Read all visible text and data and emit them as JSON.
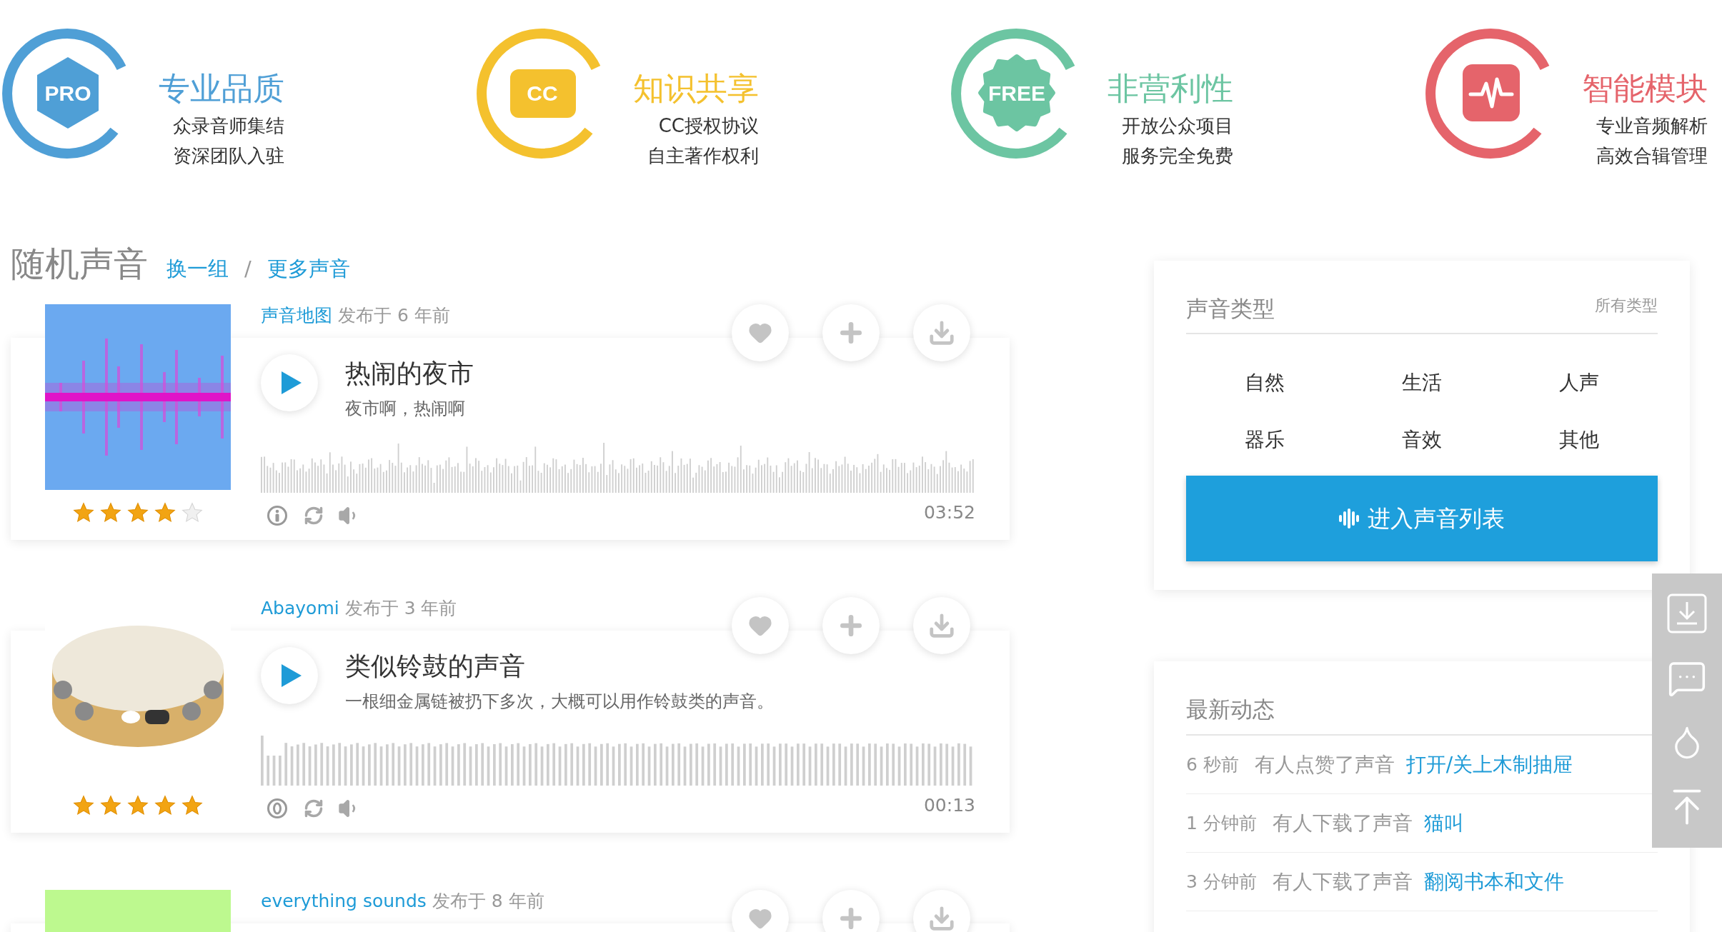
{
  "features": [
    {
      "kind": "hexagon",
      "badge": "PRO",
      "title": "专业品质",
      "lines": [
        "众录音师集结",
        "资深团队入驻"
      ],
      "color": "#4f9fd6"
    },
    {
      "kind": "rounded",
      "badge": "CC",
      "title": "知识共享",
      "lines": [
        "CC授权协议",
        "自主著作权利"
      ],
      "color": "#f4c12e"
    },
    {
      "kind": "flower",
      "badge": "FREE",
      "title": "非营利性",
      "lines": [
        "开放公众项目",
        "服务完全免费"
      ],
      "color": "#6cc5a2"
    },
    {
      "kind": "pulse",
      "title": "智能模块",
      "lines": [
        "专业音频解析",
        "高效合辑管理"
      ],
      "color": "#e5646b"
    }
  ],
  "random": {
    "title": "随机声音",
    "links": [
      "换一组",
      "更多声音"
    ],
    "separator": "/"
  },
  "sounds": [
    {
      "author": "声音地图",
      "posted": "发布于 6 年前",
      "title": "热闹的夜市",
      "description": "夜市啊，热闹啊",
      "stars": 4,
      "duration": "03:52",
      "license": {
        "kind": "attribution"
      }
    },
    {
      "author": "Abayomi",
      "posted": "发布于 3 年前",
      "title": "类似铃鼓的声音",
      "description": "一根细金属链被扔下多次，大概可以用作铃鼓类的声音。",
      "stars": 5,
      "duration": "00:13",
      "license": {
        "kind": "zero"
      }
    },
    {
      "author": "everything sounds",
      "posted": "发布于 8 年前"
    }
  ],
  "categories": {
    "title": "声音类型",
    "all_link": "所有类型",
    "items": [
      "自然",
      "生活",
      "人声",
      "器乐",
      "音效",
      "其他"
    ],
    "button": "进入声音列表"
  },
  "activity": {
    "title": "最新动态",
    "items": [
      {
        "time": "6 秒前",
        "action": "有人点赞了声音",
        "sound": "打开/关上木制抽屉"
      },
      {
        "time": "1 分钟前",
        "action": "有人下载了声音",
        "sound": "猫叫"
      },
      {
        "time": "3 分钟前",
        "action": "有人下载了声音",
        "sound": "翻阅书本和文件"
      }
    ]
  }
}
